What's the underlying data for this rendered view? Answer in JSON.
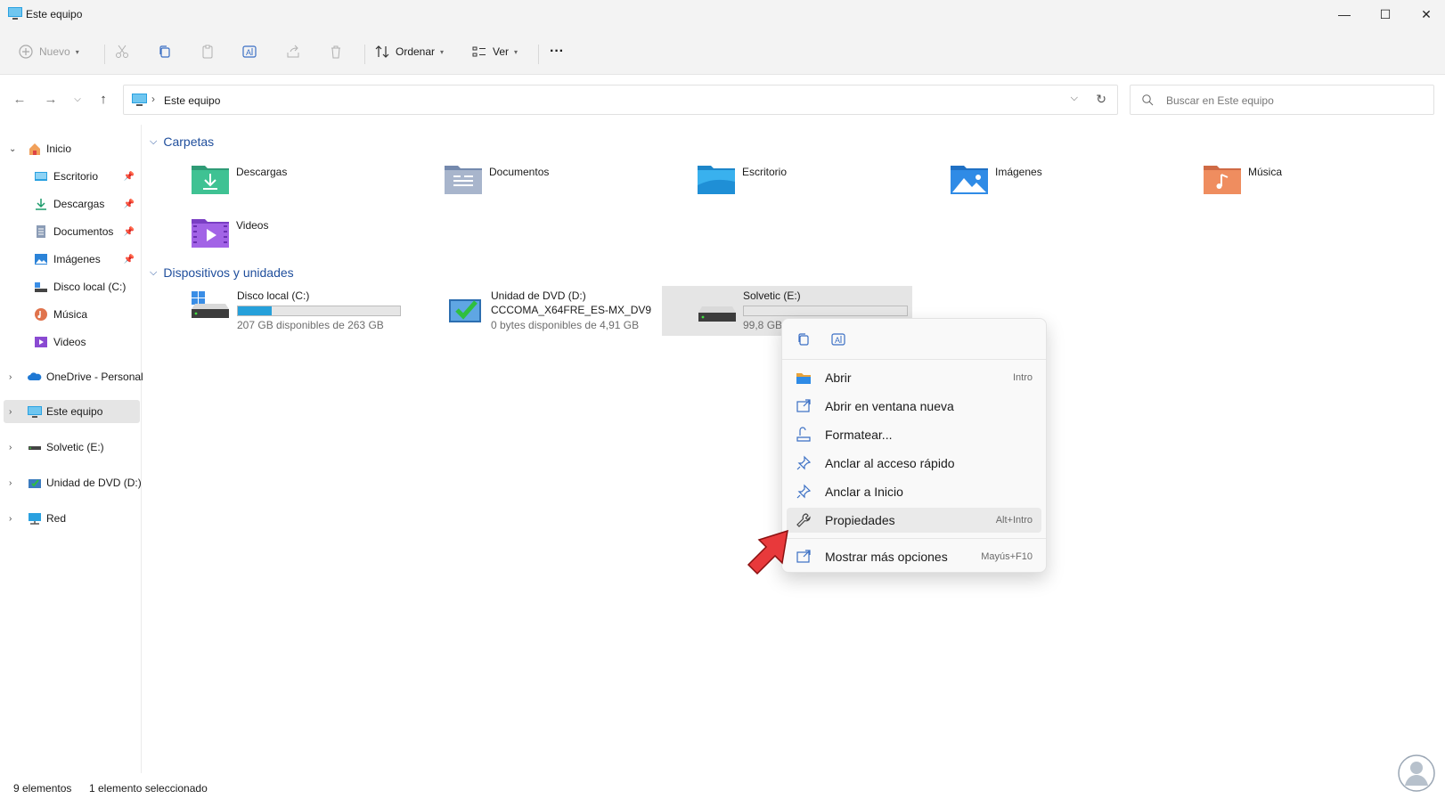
{
  "window": {
    "title": "Este equipo",
    "minimize_glyph": "—",
    "maximize_glyph": "☐",
    "close_glyph": "✕"
  },
  "toolbar": {
    "new_label": "Nuevo",
    "sort_label": "Ordenar",
    "view_label": "Ver",
    "more_label": "···"
  },
  "address": {
    "crumb": "Este equipo",
    "search_placeholder": "Buscar en Este equipo"
  },
  "sidebar": {
    "items": [
      {
        "label": "Inicio",
        "icon": "home-icon"
      },
      {
        "label": "Escritorio",
        "icon": "desktop-icon",
        "pinned": true
      },
      {
        "label": "Descargas",
        "icon": "download-icon",
        "pinned": true
      },
      {
        "label": "Documentos",
        "icon": "documents-icon",
        "pinned": true
      },
      {
        "label": "Imágenes",
        "icon": "pictures-icon",
        "pinned": true
      },
      {
        "label": "Disco local (C:)",
        "icon": "drive-icon"
      },
      {
        "label": "Música",
        "icon": "music-icon"
      },
      {
        "label": "Videos",
        "icon": "videos-icon"
      },
      {
        "label": "OneDrive - Personal",
        "icon": "onedrive-icon"
      },
      {
        "label": "Este equipo",
        "icon": "pc-icon",
        "selected": true
      },
      {
        "label": "Solvetic (E:)",
        "icon": "drive-icon"
      },
      {
        "label": "Unidad de DVD (D:)",
        "icon": "dvd-icon"
      },
      {
        "label": "Red",
        "icon": "network-icon"
      }
    ]
  },
  "sections": {
    "folders_title": "Carpetas",
    "devices_title": "Dispositivos y unidades"
  },
  "folders": [
    {
      "name": "Descargas",
      "icon": "downloads-folder-icon"
    },
    {
      "name": "Documentos",
      "icon": "documents-folder-icon"
    },
    {
      "name": "Escritorio",
      "icon": "desktop-folder-icon"
    },
    {
      "name": "Imágenes",
      "icon": "pictures-folder-icon"
    },
    {
      "name": "Música",
      "icon": "music-folder-icon"
    },
    {
      "name": "Videos",
      "icon": "videos-folder-icon"
    }
  ],
  "drives": [
    {
      "name": "Disco local (C:)",
      "sub": "207 GB disponibles de 263 GB",
      "used_fraction": 0.21
    },
    {
      "name": "Unidad de DVD (D:)",
      "name2": "CCCOMA_X64FRE_ES-MX_DV9",
      "sub": "0 bytes disponibles de 4,91 GB"
    },
    {
      "name": "Solvetic (E:)",
      "sub": "99,8 GB",
      "used_fraction": 0.0
    }
  ],
  "context_menu": {
    "items": [
      {
        "label": "Abrir",
        "key": "Intro",
        "icon": "open-folder-icon"
      },
      {
        "label": "Abrir en ventana nueva",
        "key": "",
        "icon": "open-new-window-icon"
      },
      {
        "label": "Formatear...",
        "key": "",
        "icon": "format-icon"
      },
      {
        "label": "Anclar al acceso rápido",
        "key": "",
        "icon": "pin-icon"
      },
      {
        "label": "Anclar a Inicio",
        "key": "",
        "icon": "pin-start-icon"
      },
      {
        "label": "Propiedades",
        "key": "Alt+Intro",
        "icon": "wrench-icon"
      },
      {
        "label": "Mostrar más opciones",
        "key": "Mayús+F10",
        "icon": "more-options-icon"
      }
    ]
  },
  "status": {
    "count": "9 elementos",
    "selection": "1 elemento seleccionado"
  },
  "colors": {
    "accent": "#1f4e9c",
    "progress": "#26a0da",
    "arrow": "#e8393b"
  }
}
